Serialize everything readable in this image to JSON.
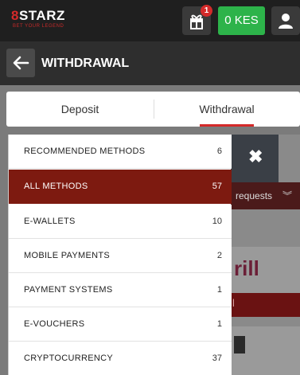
{
  "header": {
    "logo": {
      "main_prefix": "8",
      "main_suffix": "STARZ",
      "tagline": "BET YOUR LEGEND"
    },
    "gift_badge_count": "1",
    "balance": "0 KES",
    "icons": {
      "gift": "gift-icon",
      "user": "user-icon"
    }
  },
  "titlebar": {
    "title": "WITHDRAWAL",
    "back_icon": "arrow-left-icon"
  },
  "tabs": [
    {
      "label": "Deposit",
      "active": false
    },
    {
      "label": "Withdrawal",
      "active": true
    }
  ],
  "background": {
    "requests_label": "requests",
    "brand_text": "rill",
    "brand_sub": "l"
  },
  "methods": [
    {
      "label": "RECOMMENDED METHODS",
      "count": "6",
      "active": false
    },
    {
      "label": "ALL METHODS",
      "count": "57",
      "active": true
    },
    {
      "label": "E-WALLETS",
      "count": "10",
      "active": false
    },
    {
      "label": "MOBILE PAYMENTS",
      "count": "2",
      "active": false
    },
    {
      "label": "PAYMENT SYSTEMS",
      "count": "1",
      "active": false
    },
    {
      "label": "E-VOUCHERS",
      "count": "1",
      "active": false
    },
    {
      "label": "CRYPTOCURRENCY",
      "count": "37",
      "active": false
    }
  ],
  "colors": {
    "accent_red": "#d42a2a",
    "active_item": "#7d1a10",
    "balance_green": "#2db34a"
  }
}
